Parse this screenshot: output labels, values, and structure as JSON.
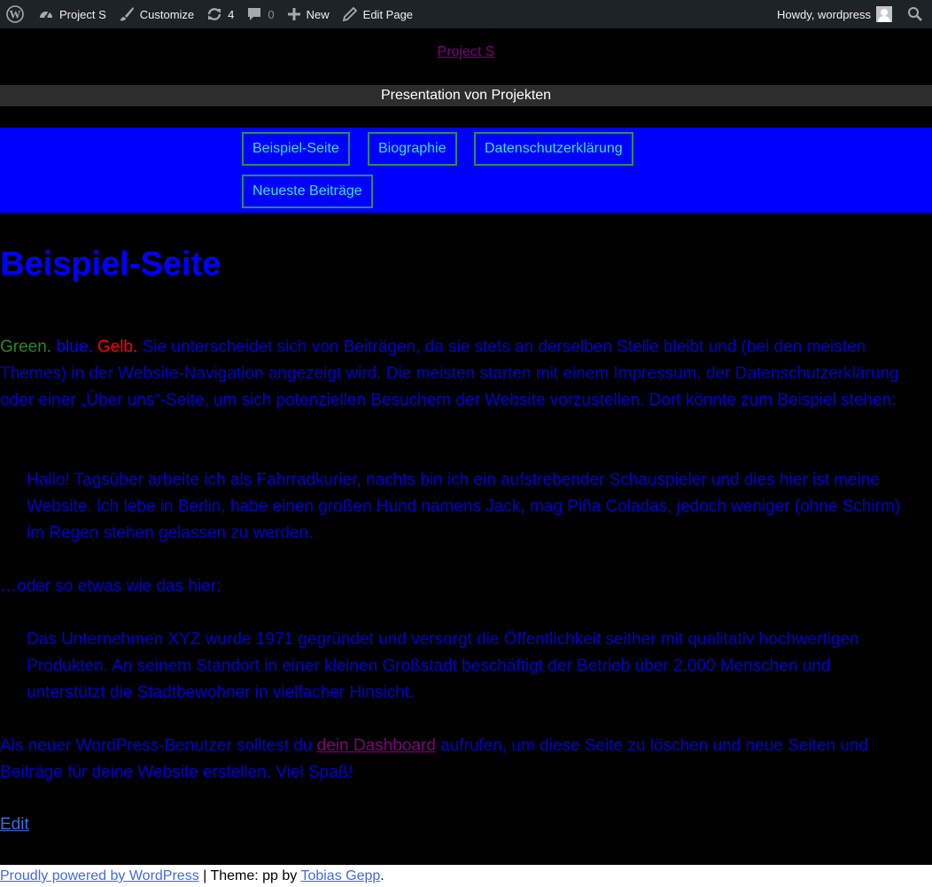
{
  "adminbar": {
    "site_name": "Project S",
    "customize": "Customize",
    "updates_count": "4",
    "comments_count": "0",
    "new_label": "New",
    "edit_page": "Edit Page",
    "greeting": "Howdy, wordpress"
  },
  "header": {
    "site_title": "Project S",
    "description": "Presentation von Projekten"
  },
  "nav": {
    "items": [
      "Beispiel-Seite",
      "Biographie",
      "Datenschutzerklärung",
      "Neueste Beiträge"
    ]
  },
  "page": {
    "title": "Beispiel-Seite",
    "intro_green": "Green.",
    "intro_blue": "blue.",
    "intro_red": "Gelb.",
    "intro_text": "Sie unterscheidet sich von Beiträgen, da sie stets an derselben Stelle bleibt und (bei den meisten Themes) in der Website-Navigation angezeigt wird. Die meisten starten mit einem Impressum, der Datenschutzerklärung oder einer „Über uns“-Seite, um sich potenziellen Besuchern der Website vorzustellen. Dort könnte zum Beispiel stehen:",
    "quote1": "Hallo! Tagsüber arbeite ich als Fahrradkurier, nachts bin ich ein aufstrebender Schauspieler und dies hier ist meine Website. Ich lebe in Berlin, habe einen großen Hund namens Jack, mag Piña Coladas, jedoch weniger (ohne Schirm) im Regen stehen gelassen zu werden.",
    "middle": "…oder so etwas wie das hier:",
    "quote2": "Das Unternehmen XYZ wurde 1971 gegründet und versorgt die Öffentlichkeit seither mit qualitativ hochwertigen Produkten. An seinem Standort in einer kleinen Großstadt beschäftigt der Betrieb über 2.000 Menschen und unterstützt die Stadtbewohner in vielfacher Hinsicht.",
    "outro_before": "Als neuer WordPress-Benutzer solltest du",
    "outro_link": "dein Dashboard",
    "outro_after": "aufrufen, um diese Seite zu löschen und neue Seiten und Beiträge für deine Website erstellen. Viel Spaß!",
    "edit": "Edit"
  },
  "footer": {
    "powered": "Proudly powered by WordPress",
    "separator": "| Theme: pp by",
    "author": "Tobias Gepp",
    "end": "."
  },
  "colors": {
    "nav_background": "#0000ff",
    "nav_text": "#40e0d0",
    "nav_border": "#2e8b57",
    "body_text": "#0000cd",
    "page_background": "#000000"
  }
}
